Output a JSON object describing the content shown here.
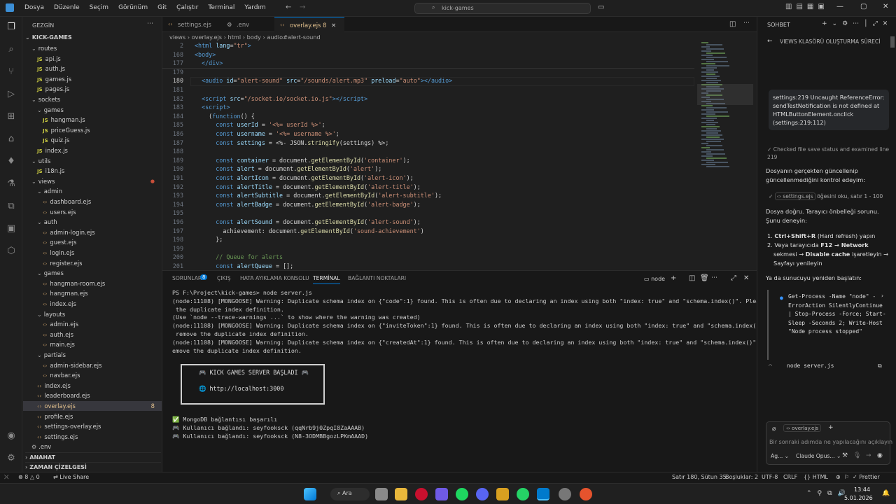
{
  "menu": [
    "Dosya",
    "Düzenle",
    "Seçim",
    "Görünüm",
    "Git",
    "Çalıştır",
    "Terminal",
    "Yardım"
  ],
  "search": "kick-games",
  "explorer": {
    "title": "GEZGİN",
    "root": "KICK-GAMES",
    "rows": [
      {
        "label": "routes",
        "kind": "folder",
        "indent": 1
      },
      {
        "label": "api.js",
        "kind": "js",
        "indent": 2
      },
      {
        "label": "auth.js",
        "kind": "js",
        "indent": 2
      },
      {
        "label": "games.js",
        "kind": "js",
        "indent": 2
      },
      {
        "label": "pages.js",
        "kind": "js",
        "indent": 2
      },
      {
        "label": "sockets",
        "kind": "folder",
        "indent": 1
      },
      {
        "label": "games",
        "kind": "folder",
        "indent": 2
      },
      {
        "label": "hangman.js",
        "kind": "js",
        "indent": 3
      },
      {
        "label": "priceGuess.js",
        "kind": "js",
        "indent": 3
      },
      {
        "label": "quiz.js",
        "kind": "js",
        "indent": 3
      },
      {
        "label": "index.js",
        "kind": "js",
        "indent": 2
      },
      {
        "label": "utils",
        "kind": "folder",
        "indent": 1
      },
      {
        "label": "i18n.js",
        "kind": "js",
        "indent": 2
      },
      {
        "label": "views",
        "kind": "folder",
        "indent": 1,
        "red": true
      },
      {
        "label": "admin",
        "kind": "folder",
        "indent": 2
      },
      {
        "label": "dashboard.ejs",
        "kind": "ejs",
        "indent": 3
      },
      {
        "label": "users.ejs",
        "kind": "ejs",
        "indent": 3
      },
      {
        "label": "auth",
        "kind": "folder",
        "indent": 2
      },
      {
        "label": "admin-login.ejs",
        "kind": "ejs",
        "indent": 3
      },
      {
        "label": "guest.ejs",
        "kind": "ejs",
        "indent": 3
      },
      {
        "label": "login.ejs",
        "kind": "ejs",
        "indent": 3
      },
      {
        "label": "register.ejs",
        "kind": "ejs",
        "indent": 3
      },
      {
        "label": "games",
        "kind": "folder",
        "indent": 2
      },
      {
        "label": "hangman-room.ejs",
        "kind": "ejs",
        "indent": 3
      },
      {
        "label": "hangman.ejs",
        "kind": "ejs",
        "indent": 3
      },
      {
        "label": "index.ejs",
        "kind": "ejs",
        "indent": 3
      },
      {
        "label": "layouts",
        "kind": "folder",
        "indent": 2
      },
      {
        "label": "admin.ejs",
        "kind": "ejs",
        "indent": 3
      },
      {
        "label": "auth.ejs",
        "kind": "ejs",
        "indent": 3
      },
      {
        "label": "main.ejs",
        "kind": "ejs",
        "indent": 3
      },
      {
        "label": "partials",
        "kind": "folder",
        "indent": 2
      },
      {
        "label": "admin-sidebar.ejs",
        "kind": "ejs",
        "indent": 3
      },
      {
        "label": "navbar.ejs",
        "kind": "ejs",
        "indent": 3
      },
      {
        "label": "index.ejs",
        "kind": "ejs",
        "indent": 2
      },
      {
        "label": "leaderboard.ejs",
        "kind": "ejs",
        "indent": 2
      },
      {
        "label": "overlay.ejs",
        "kind": "ejs",
        "indent": 2,
        "selected": true,
        "badge": "8"
      },
      {
        "label": "profile.ejs",
        "kind": "ejs",
        "indent": 2
      },
      {
        "label": "settings-overlay.ejs",
        "kind": "ejs",
        "indent": 2
      },
      {
        "label": "settings.ejs",
        "kind": "ejs",
        "indent": 2
      },
      {
        "label": ".env",
        "kind": "gear",
        "indent": 1
      }
    ],
    "outline": "ANAHAT",
    "timeline": "ZAMAN ÇİZELGESİ"
  },
  "tabs": [
    {
      "label": "settings.ejs"
    },
    {
      "label": ".env"
    },
    {
      "label": "overlay.ejs",
      "badge": "8",
      "active": true
    }
  ],
  "breadcrumb": [
    "views",
    "overlay.ejs",
    "html",
    "body",
    "audio#alert-sound"
  ],
  "code": [
    {
      "n": "2",
      "html": "<span class='t'>&lt;html</span> <span class='a'>lang</span>=<span class='s'>\"tr\"</span><span class='t'>&gt;</span>"
    },
    {
      "n": "168",
      "html": "<span class='t'>&lt;body&gt;</span>"
    },
    {
      "n": "177",
      "html": "  <span class='t'>&lt;/div&gt;</span>"
    },
    {
      "n": "179",
      "html": ""
    },
    {
      "n": "180",
      "html": "  <span class='t'>&lt;audio</span> <span class='a'>id</span>=<span class='s'>\"alert-sound\"</span> <span class='a'>src</span>=<span class='s'>\"/sounds/alert.mp3\"</span> <span class='a'>preload</span>=<span class='s'>\"auto\"</span><span class='t'>&gt;&lt;/audio&gt;</span>"
    },
    {
      "n": "181",
      "html": ""
    },
    {
      "n": "182",
      "html": "  <span class='t'>&lt;script</span> <span class='a'>src</span>=<span class='s'>\"/socket.io/socket.io.js\"</span><span class='t'>&gt;&lt;/script&gt;</span>"
    },
    {
      "n": "183",
      "html": "  <span class='t'>&lt;script&gt;</span>"
    },
    {
      "n": "184",
      "html": "    (<span class='k'>function</span>() {"
    },
    {
      "n": "185",
      "html": "      <span class='k'>const</span> <span class='v'>userId</span> = <span class='s'>'&lt;%= userId %&gt;'</span>;"
    },
    {
      "n": "186",
      "html": "      <span class='k'>const</span> <span class='v'>username</span> = <span class='s'>'&lt;%= username %&gt;'</span>;"
    },
    {
      "n": "187",
      "html": "      <span class='k'>const</span> <span class='v'>settings</span> = &lt;%- JSON.<span class='f'>stringify</span>(settings) %&gt;;"
    },
    {
      "n": "188",
      "html": ""
    },
    {
      "n": "189",
      "html": "      <span class='k'>const</span> <span class='v'>container</span> = document.<span class='f'>getElementById</span>(<span class='s'>'container'</span>);"
    },
    {
      "n": "190",
      "html": "      <span class='k'>const</span> <span class='v'>alert</span> = document.<span class='f'>getElementById</span>(<span class='s'>'alert'</span>);"
    },
    {
      "n": "191",
      "html": "      <span class='k'>const</span> <span class='v'>alertIcon</span> = document.<span class='f'>getElementById</span>(<span class='s'>'alert-icon'</span>);"
    },
    {
      "n": "192",
      "html": "      <span class='k'>const</span> <span class='v'>alertTitle</span> = document.<span class='f'>getElementById</span>(<span class='s'>'alert-title'</span>);"
    },
    {
      "n": "193",
      "html": "      <span class='k'>const</span> <span class='v'>alertSubtitle</span> = document.<span class='f'>getElementById</span>(<span class='s'>'alert-subtitle'</span>);"
    },
    {
      "n": "194",
      "html": "      <span class='k'>const</span> <span class='v'>alertBadge</span> = document.<span class='f'>getElementById</span>(<span class='s'>'alert-badge'</span>);"
    },
    {
      "n": "195",
      "html": ""
    },
    {
      "n": "196",
      "html": "      <span class='k'>const</span> <span class='v'>alertSound</span> = document.<span class='f'>getElementById</span>(<span class='s'>'alert-sound'</span>);"
    },
    {
      "n": "197",
      "html": "        achievement: document.<span class='f'>getElementById</span>(<span class='s'>'sound-achievement'</span>)"
    },
    {
      "n": "198",
      "html": "      };"
    },
    {
      "n": "199",
      "html": ""
    },
    {
      "n": "200",
      "html": "      <span class='c'>// Queue for alerts</span>"
    },
    {
      "n": "201",
      "html": "      <span class='k'>const</span> <span class='v'>alertQueue</span> = [];"
    }
  ],
  "panel": {
    "tabs": [
      "SORUNLAR",
      "ÇIKIŞ",
      "HATA AYIKLAMA KONSOLU",
      "TERMİNAL",
      "BAĞLANTI NOKTALARI"
    ],
    "problems_badge": "8",
    "shell": "node",
    "lines": [
      "PS F:\\Project\\kick-games> node server.js",
      "(node:11108) [MONGOOSE] Warning: Duplicate schema index on {\"code\":1} found. This is often due to declaring an index using both \"index: true\" and \"schema.index()\". Please remove",
      " the duplicate index definition.",
      "(Use `node --trace-warnings ...` to show where the warning was created)",
      "(node:11108) [MONGOOSE] Warning: Duplicate schema index on {\"inviteToken\":1} found. This is often due to declaring an index using both \"index: true\" and \"schema.index()\". Please",
      " remove the duplicate index definition.",
      "(node:11108) [MONGOOSE] Warning: Duplicate schema index on {\"createdAt\":1} found. This is often due to declaring an index using both \"index: true\" and \"schema.index()\". Please r",
      "emove the duplicate index definition."
    ],
    "box_title": "🎮 KICK GAMES SERVER BAŞLADI 🎮",
    "box_url": "🌐 http://localhost:3000",
    "tail": [
      "✅ MongoDB bağlantısı başarılı",
      "🎮 Kullanıcı bağlandı: seyfooksck (qqNrb9j0ZpqI8ZaAAAB)",
      "🎮 Kullanıcı bağlandı: seyfooksck (N8-3ODMBBgozLPKmAAAD)"
    ]
  },
  "chat": {
    "title": "SOHBET",
    "thread": "VIEWS KLASÖRÜ OLUŞTURMA SÜRECİ",
    "user_msg": "settings:219 Uncaught ReferenceError: sendTestNotification is not defined at HTMLButtonElement.onclick (settings:219:112)",
    "step1": "Checked file save status and examined line 219",
    "p1": "Dosyanın gerçekten güncellenip güncellenmediğini kontrol edeyim:",
    "step2_file": "settings.ejs",
    "step2": "öğesini oku, satır 1 - 100",
    "p2": "Dosya doğru. Tarayıcı önbelleği sorunu. Şunu deneyin:",
    "li1a": "Ctrl+Shift+R",
    "li1b": " (Hard refresh) yapın",
    "li2a": "Veya tarayıcıda ",
    "li2b": "F12 → Network",
    "li2c": " sekmesi → ",
    "li2d": "Disable cache",
    "li2e": " işaretleyin → Sayfayı yenileyin",
    "p3": "Ya da sunucuyu yeniden başlatın:",
    "cmd": "Get-Process -Name \"node\" -ErrorAction SilentlyContinue | Stop-Process -Force; Start-Sleep -Seconds 2; Write-Host \"Node process stopped\"",
    "cmd2": "node server.js",
    "ctx_file": "overlay.ejs",
    "input_placeholder": "Bir sonraki adımda ne yapılacağını açıklayın",
    "mode": "Ag...",
    "model": "Claude Opus..."
  },
  "status": {
    "errors": "8",
    "warnings": "0",
    "liveshare": "Live Share",
    "position": "Satır 180, Sütun 35",
    "spaces": "Boşluklar: 2",
    "encoding": "UTF-8",
    "eol": "CRLF",
    "lang": "HTML",
    "prettier": "Prettier"
  },
  "taskbar": {
    "search": "Ara",
    "time": "13:44",
    "date": "5.01.2026"
  }
}
